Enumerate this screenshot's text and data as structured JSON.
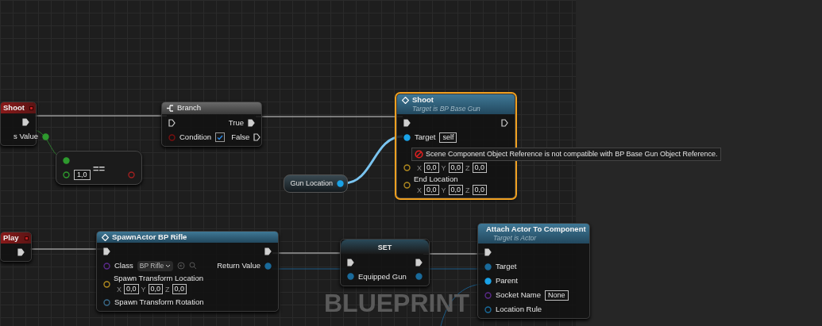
{
  "graph_watermark": "BLUEPRINT",
  "nodes": [
    {
      "kind": "event",
      "title": "Shoot",
      "selected": false,
      "rows": [
        {
          "right": {
            "kind": "exec",
            "connected": true
          }
        },
        {
          "right": {
            "kind": "data",
            "label": "s Value",
            "color": "#2e9a2e",
            "connected": true
          }
        }
      ]
    },
    {
      "kind": "flow",
      "title": "Branch",
      "selected": false,
      "rows": [
        {
          "left": {
            "kind": "exec",
            "connected": false
          },
          "right": {
            "kind": "exec",
            "label": "True",
            "connected": true
          }
        },
        {
          "left": {
            "kind": "data",
            "label": "Condition",
            "color": "#7a1010",
            "connected": false,
            "checked": true
          },
          "right": {
            "kind": "exec",
            "label": "False",
            "connected": false
          }
        }
      ]
    },
    {
      "kind": "operator",
      "title": "==",
      "selected": false,
      "rows": [
        {
          "left": {
            "kind": "data",
            "color": "#2e9a2e",
            "connected": true
          }
        },
        {
          "left": {
            "kind": "data",
            "color": "#2e9a2e",
            "connected": false,
            "value": "1,0"
          },
          "right": {
            "kind": "data",
            "color": "#a02020",
            "connected": false
          }
        }
      ]
    },
    {
      "kind": "getter",
      "title": "Gun Location",
      "selected": false,
      "rows": [
        {
          "right": {
            "kind": "data",
            "color": "#1aa3e8",
            "connected": true
          }
        }
      ]
    },
    {
      "kind": "function",
      "title": "Shoot",
      "subtitle": "Target is BP Base Gun",
      "selected": true,
      "rows": [
        {
          "left": {
            "kind": "exec",
            "connected": true
          },
          "right": {
            "kind": "exec",
            "connected": false
          }
        },
        {
          "left": {
            "kind": "data",
            "label": "Target",
            "color": "#1aa3e8",
            "connected": true,
            "value": "self"
          }
        },
        {
          "left": {
            "kind": "data",
            "color": "#b08a20",
            "connected": false,
            "vector": [
              {
                "axis": "X",
                "value": "0,0"
              },
              {
                "axis": "Y",
                "value": "0,0"
              },
              {
                "axis": "Z",
                "value": "0,0"
              }
            ]
          }
        },
        {
          "left": {
            "kind": "data",
            "label": "End Location",
            "color": "#b08a20",
            "connected": false,
            "vector": [
              {
                "axis": "X",
                "value": "0,0"
              },
              {
                "axis": "Y",
                "value": "0,0"
              },
              {
                "axis": "Z",
                "value": "0,0"
              }
            ]
          }
        }
      ]
    },
    {
      "kind": "event",
      "title": "Play",
      "selected": false,
      "rows": [
        {
          "right": {
            "kind": "exec",
            "connected": true
          }
        }
      ]
    },
    {
      "kind": "function",
      "title": "SpawnActor BP Rifle",
      "selected": false,
      "rows": [
        {
          "left": {
            "kind": "exec",
            "connected": true
          },
          "right": {
            "kind": "exec",
            "connected": true
          }
        },
        {
          "left": {
            "kind": "data",
            "label": "Class",
            "color": "#5a2a8a",
            "connected": false,
            "dropdown": "BP Rifle"
          },
          "right": {
            "kind": "data",
            "label": "Return Value",
            "color": "#1a6a9a",
            "connected": true
          }
        },
        {
          "left": {
            "kind": "data",
            "label": "Spawn Transform Location",
            "color": "#b08a20",
            "connected": false,
            "vector": [
              {
                "axis": "X",
                "value": "0,0"
              },
              {
                "axis": "Y",
                "value": "0,0"
              },
              {
                "axis": "Z",
                "value": "0,0"
              }
            ]
          }
        },
        {
          "left": {
            "kind": "data",
            "label": "Spawn Transform Rotation",
            "color": "#3a6a8a",
            "connected": false
          }
        }
      ]
    },
    {
      "kind": "setter",
      "title": "SET",
      "selected": false,
      "rows": [
        {
          "left": {
            "kind": "exec",
            "connected": true
          },
          "right": {
            "kind": "exec",
            "connected": true
          }
        },
        {
          "left": {
            "kind": "data",
            "label": "Equipped Gun",
            "color": "#1a6a9a",
            "connected": true
          },
          "right": {
            "kind": "data",
            "color": "#1a6a9a",
            "connected": true
          }
        }
      ]
    },
    {
      "kind": "function",
      "title": "Attach Actor To Component",
      "subtitle": "Target is Actor",
      "selected": false,
      "rows": [
        {
          "left": {
            "kind": "exec",
            "connected": true
          }
        },
        {
          "left": {
            "kind": "data",
            "label": "Target",
            "color": "#1a6a9a",
            "connected": true
          }
        },
        {
          "left": {
            "kind": "data",
            "label": "Parent",
            "color": "#1aa3e8",
            "connected": true
          }
        },
        {
          "left": {
            "kind": "data",
            "label": "Socket Name",
            "color": "#5a2a8a",
            "connected": false,
            "value": "None"
          }
        },
        {
          "left": {
            "kind": "data",
            "label": "Location Rule",
            "color": "#1a6a9a",
            "connected": false
          }
        }
      ]
    }
  ],
  "error_tooltip": {
    "text": "Scene Component Object Reference is not compatible with BP Base Gun Object Reference."
  }
}
